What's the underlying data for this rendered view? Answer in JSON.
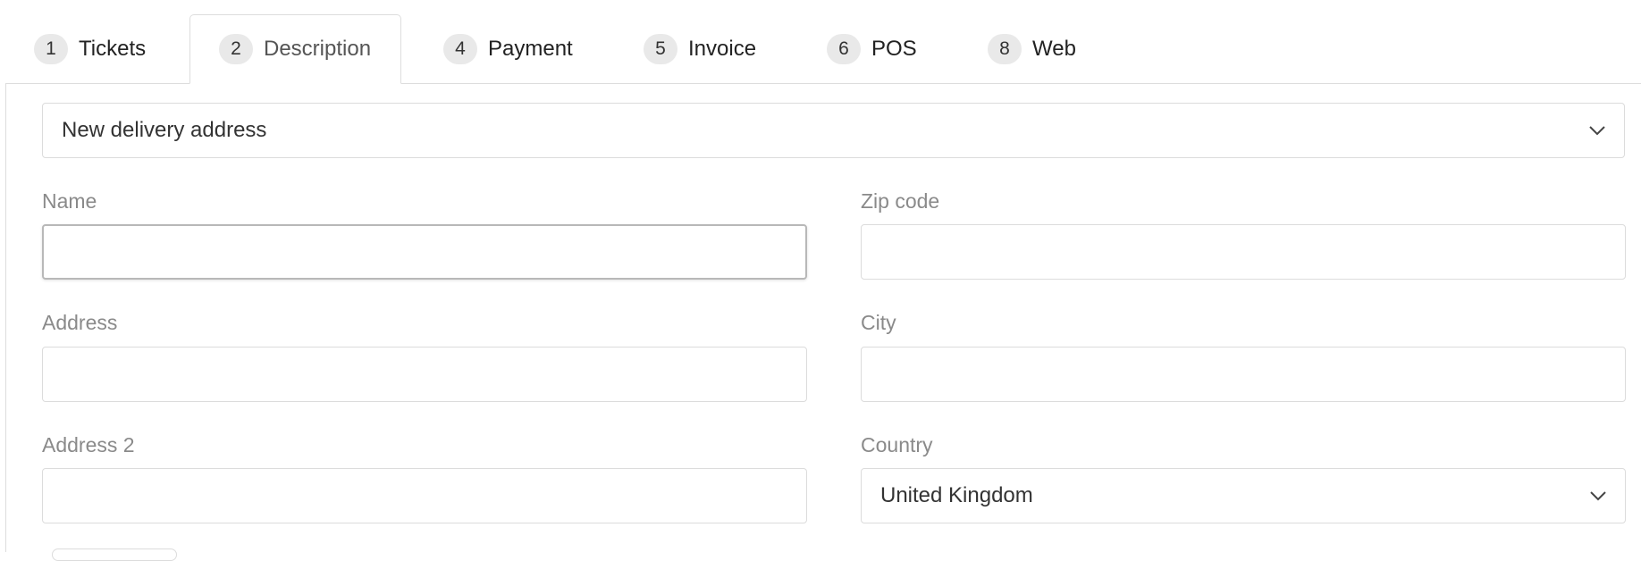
{
  "tabs": [
    {
      "number": "1",
      "label": "Tickets"
    },
    {
      "number": "2",
      "label": "Description"
    },
    {
      "number": "4",
      "label": "Payment"
    },
    {
      "number": "5",
      "label": "Invoice"
    },
    {
      "number": "6",
      "label": "POS"
    },
    {
      "number": "8",
      "label": "Web"
    }
  ],
  "active_tab": "Description",
  "delivery": {
    "selected": "New delivery address",
    "icon": "chevron-down-icon"
  },
  "form": {
    "name": {
      "label": "Name",
      "value": ""
    },
    "zip": {
      "label": "Zip code",
      "value": ""
    },
    "address": {
      "label": "Address",
      "value": ""
    },
    "city": {
      "label": "City",
      "value": ""
    },
    "address2": {
      "label": "Address 2",
      "value": ""
    },
    "country": {
      "label": "Country",
      "selected": "United Kingdom",
      "icon": "chevron-down-icon"
    }
  },
  "colors": {
    "border": "#dddddd",
    "badge_bg": "#e9e9e9",
    "label_text": "#8a8a8a"
  }
}
